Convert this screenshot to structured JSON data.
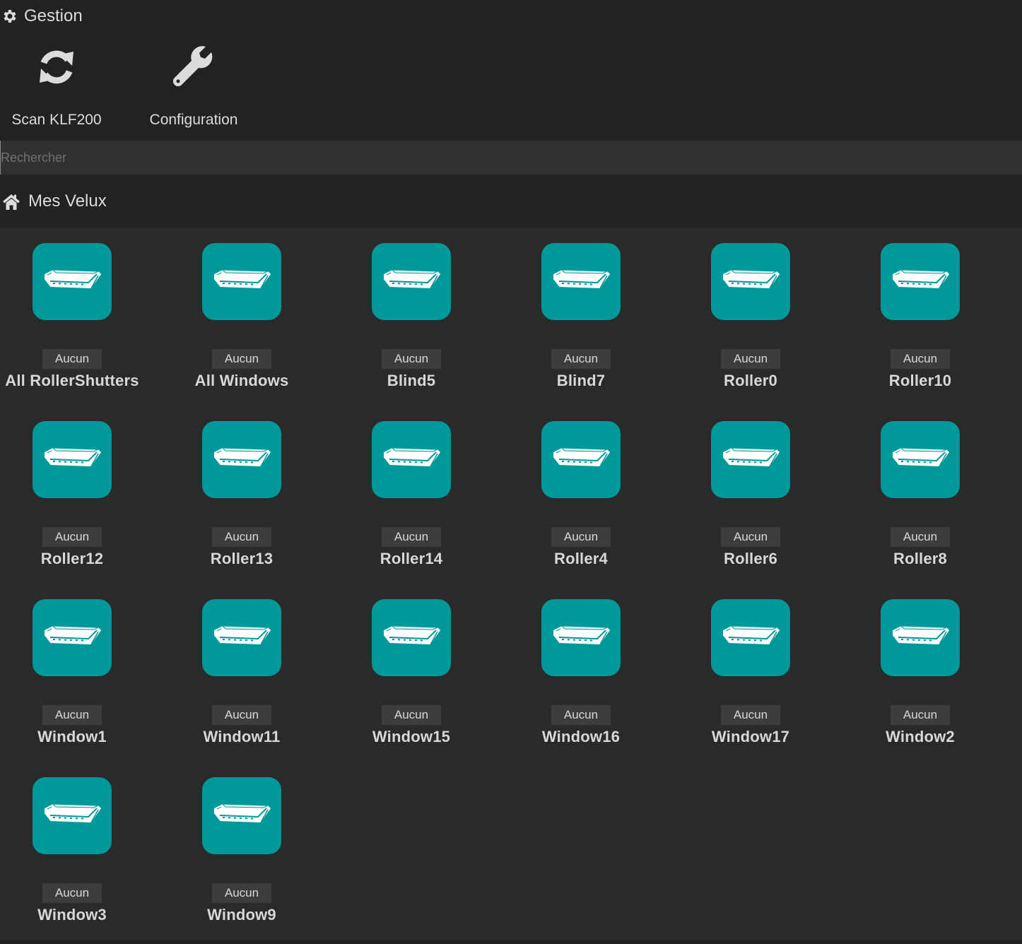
{
  "gestion": {
    "title": "Gestion",
    "icon": "gear-icon",
    "actions": [
      {
        "label": "Scan KLF200",
        "icon": "sync-icon"
      },
      {
        "label": "Configuration",
        "icon": "wrench-icon"
      }
    ]
  },
  "search": {
    "placeholder": "Rechercher",
    "value": ""
  },
  "section": {
    "title": "Mes Velux",
    "icon": "home-icon"
  },
  "colors": {
    "tile": "#009999",
    "background": "#222222",
    "grid_bg": "#292a2a"
  },
  "devices": [
    {
      "name": "All RollerShutters",
      "badge": "Aucun",
      "icon": "velux-window-icon"
    },
    {
      "name": "All Windows",
      "badge": "Aucun",
      "icon": "velux-window-icon"
    },
    {
      "name": "Blind5",
      "badge": "Aucun",
      "icon": "velux-window-icon"
    },
    {
      "name": "Blind7",
      "badge": "Aucun",
      "icon": "velux-window-icon"
    },
    {
      "name": "Roller0",
      "badge": "Aucun",
      "icon": "velux-window-icon"
    },
    {
      "name": "Roller10",
      "badge": "Aucun",
      "icon": "velux-window-icon"
    },
    {
      "name": "Roller12",
      "badge": "Aucun",
      "icon": "velux-window-icon"
    },
    {
      "name": "Roller13",
      "badge": "Aucun",
      "icon": "velux-window-icon"
    },
    {
      "name": "Roller14",
      "badge": "Aucun",
      "icon": "velux-window-icon"
    },
    {
      "name": "Roller4",
      "badge": "Aucun",
      "icon": "velux-window-icon"
    },
    {
      "name": "Roller6",
      "badge": "Aucun",
      "icon": "velux-window-icon"
    },
    {
      "name": "Roller8",
      "badge": "Aucun",
      "icon": "velux-window-icon"
    },
    {
      "name": "Window1",
      "badge": "Aucun",
      "icon": "velux-window-icon"
    },
    {
      "name": "Window11",
      "badge": "Aucun",
      "icon": "velux-window-icon"
    },
    {
      "name": "Window15",
      "badge": "Aucun",
      "icon": "velux-window-icon"
    },
    {
      "name": "Window16",
      "badge": "Aucun",
      "icon": "velux-window-icon"
    },
    {
      "name": "Window17",
      "badge": "Aucun",
      "icon": "velux-window-icon"
    },
    {
      "name": "Window2",
      "badge": "Aucun",
      "icon": "velux-window-icon"
    },
    {
      "name": "Window3",
      "badge": "Aucun",
      "icon": "velux-window-icon"
    },
    {
      "name": "Window9",
      "badge": "Aucun",
      "icon": "velux-window-icon"
    }
  ]
}
